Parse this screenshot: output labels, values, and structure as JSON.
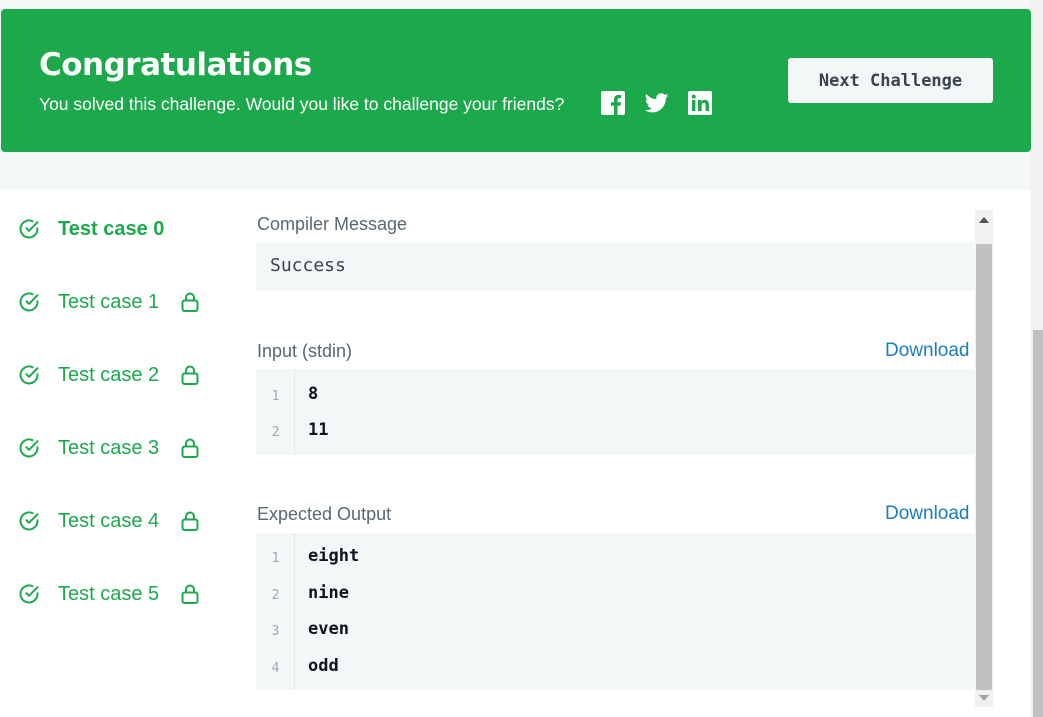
{
  "banner": {
    "title": "Congratulations",
    "subtitle": "You solved this challenge. Would you like to challenge your friends?",
    "social_icons": [
      "facebook-icon",
      "twitter-icon",
      "linkedin-icon"
    ],
    "next_button": "Next Challenge",
    "color": "#1ba94c"
  },
  "test_cases": [
    {
      "label": "Test case 0",
      "active": true,
      "locked": false
    },
    {
      "label": "Test case 1",
      "active": false,
      "locked": true
    },
    {
      "label": "Test case 2",
      "active": false,
      "locked": true
    },
    {
      "label": "Test case 3",
      "active": false,
      "locked": true
    },
    {
      "label": "Test case 4",
      "active": false,
      "locked": true
    },
    {
      "label": "Test case 5",
      "active": false,
      "locked": true
    }
  ],
  "compiler": {
    "label": "Compiler Message",
    "message": "Success"
  },
  "input": {
    "label": "Input (stdin)",
    "download": "Download",
    "lines": [
      {
        "n": "1",
        "text": "8"
      },
      {
        "n": "2",
        "text": "11"
      }
    ]
  },
  "output": {
    "label": "Expected Output",
    "download": "Download",
    "lines": [
      {
        "n": "1",
        "text": "eight"
      },
      {
        "n": "2",
        "text": "nine"
      },
      {
        "n": "3",
        "text": "even"
      },
      {
        "n": "4",
        "text": "odd"
      }
    ]
  }
}
